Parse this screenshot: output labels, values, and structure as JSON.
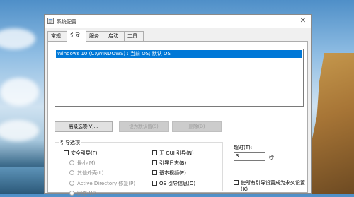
{
  "window": {
    "title": "系统配置",
    "close": "✕"
  },
  "tabs": [
    {
      "label": "常规"
    },
    {
      "label": "引导"
    },
    {
      "label": "服务"
    },
    {
      "label": "启动"
    },
    {
      "label": "工具"
    }
  ],
  "boot_list": {
    "entries": [
      "Windows 10 (C:\\WINDOWS) : 当前 OS; 默认 OS"
    ]
  },
  "buttons": {
    "advanced": "高级选项(V)...",
    "set_default": "设为默认值(S)",
    "delete": "删除(D)"
  },
  "boot_options": {
    "label": "引导选项",
    "safe_boot": "安全引导(F)",
    "minimal": "最小(M)",
    "alternate_shell": "其他外壳(L)",
    "active_directory": "Active Directory 修复(P)",
    "network": "网络(W)",
    "no_gui": "无 GUI 引导(N)",
    "boot_log": "引导日志(B)",
    "base_video": "基本视频(E)",
    "os_boot_info": "OS 引导信息(O)"
  },
  "timeout": {
    "label": "超时(T):",
    "value": "3",
    "unit": "秒"
  },
  "permanent": {
    "label_line1": "使所有引导设置成为永久设置",
    "label_line2": "(K)"
  }
}
